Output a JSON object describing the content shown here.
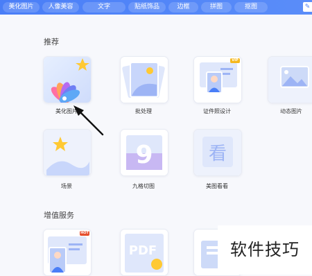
{
  "top_tabs": [
    "美化图片",
    "人像美容",
    "文字",
    "贴纸饰品",
    "边框",
    "拼图",
    "抠图"
  ],
  "top_right_icon": "edit-icon",
  "sections": {
    "recommend_title": "推荐",
    "value_added_title": "增值服务"
  },
  "tiles": {
    "beautify": "美化图片",
    "batch": "批处理",
    "id_photo": "证件照设计",
    "animated": "动态图片",
    "scene": "场景",
    "grid_cut": "九格切图",
    "meitu_view": "美图看看"
  },
  "badges": {
    "vip": "VIP",
    "hot": "HOT"
  },
  "watermark": "软件技巧",
  "colors": {
    "accent": "#4a7ef7",
    "background": "#f7f8fc"
  }
}
